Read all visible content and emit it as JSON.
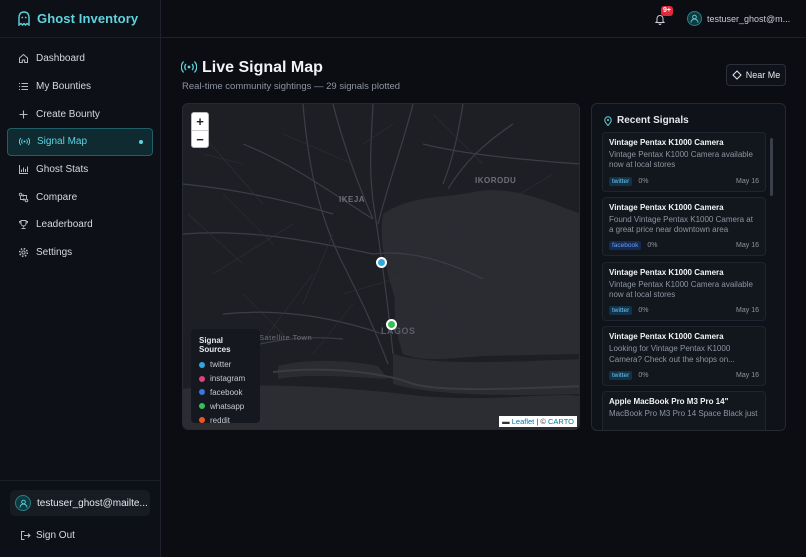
{
  "app": {
    "name": "Ghost Inventory"
  },
  "sidebar": {
    "items": [
      {
        "label": "Dashboard",
        "icon": "home-icon"
      },
      {
        "label": "My Bounties",
        "icon": "list-icon"
      },
      {
        "label": "Create Bounty",
        "icon": "plus-icon"
      },
      {
        "label": "Signal Map",
        "icon": "radio-signal-icon",
        "active": true
      },
      {
        "label": "Ghost Stats",
        "icon": "bar-chart-icon"
      },
      {
        "label": "Compare",
        "icon": "compare-arrows-icon"
      },
      {
        "label": "Leaderboard",
        "icon": "trophy-icon"
      },
      {
        "label": "Settings",
        "icon": "gear-icon"
      }
    ],
    "user": "testuser_ghost@mailte...",
    "signout": "Sign Out"
  },
  "topbar": {
    "notifications_badge": "9+",
    "user": "testuser_ghost@m..."
  },
  "page": {
    "title": "Live Signal Map",
    "subtitle": "Real-time community sightings — 29 signals plotted",
    "near_me": "Near Me"
  },
  "map": {
    "zoom_in": "+",
    "zoom_out": "−",
    "labels": [
      "IKORODU",
      "IKEJA",
      "LAGOS",
      "Satellite Town"
    ],
    "legend": {
      "title": "Signal Sources",
      "items": [
        {
          "name": "twitter",
          "color": "#2fa8e0"
        },
        {
          "name": "instagram",
          "color": "#e0417a"
        },
        {
          "name": "facebook",
          "color": "#3b74e3"
        },
        {
          "name": "whatsapp",
          "color": "#35c15a"
        },
        {
          "name": "reddit",
          "color": "#f0551f"
        }
      ]
    },
    "attribution": {
      "leaflet": "Leaflet",
      "sep": " | © ",
      "carto": "CARTO"
    }
  },
  "recent": {
    "title": "Recent Signals",
    "items": [
      {
        "title": "Vintage Pentax K1000 Camera",
        "desc": "Vintage Pentax K1000 Camera available now at local stores",
        "source": "twitter",
        "pct": "0%",
        "date": "May 16"
      },
      {
        "title": "Vintage Pentax K1000 Camera",
        "desc": "Found Vintage Pentax K1000 Camera at a great price near downtown area",
        "source": "facebook",
        "pct": "0%",
        "date": "May 16"
      },
      {
        "title": "Vintage Pentax K1000 Camera",
        "desc": "Vintage Pentax K1000 Camera available now at local stores",
        "source": "twitter",
        "pct": "0%",
        "date": "May 16"
      },
      {
        "title": "Vintage Pentax K1000 Camera",
        "desc": "Looking for Vintage Pentax K1000 Camera? Check out the shops on...",
        "source": "twitter",
        "pct": "0%",
        "date": "May 16"
      },
      {
        "title": "Apple MacBook Pro M3 Pro 14\"",
        "desc": "MacBook Pro M3 Pro 14 Space Black just",
        "source": "",
        "pct": "",
        "date": ""
      }
    ]
  }
}
